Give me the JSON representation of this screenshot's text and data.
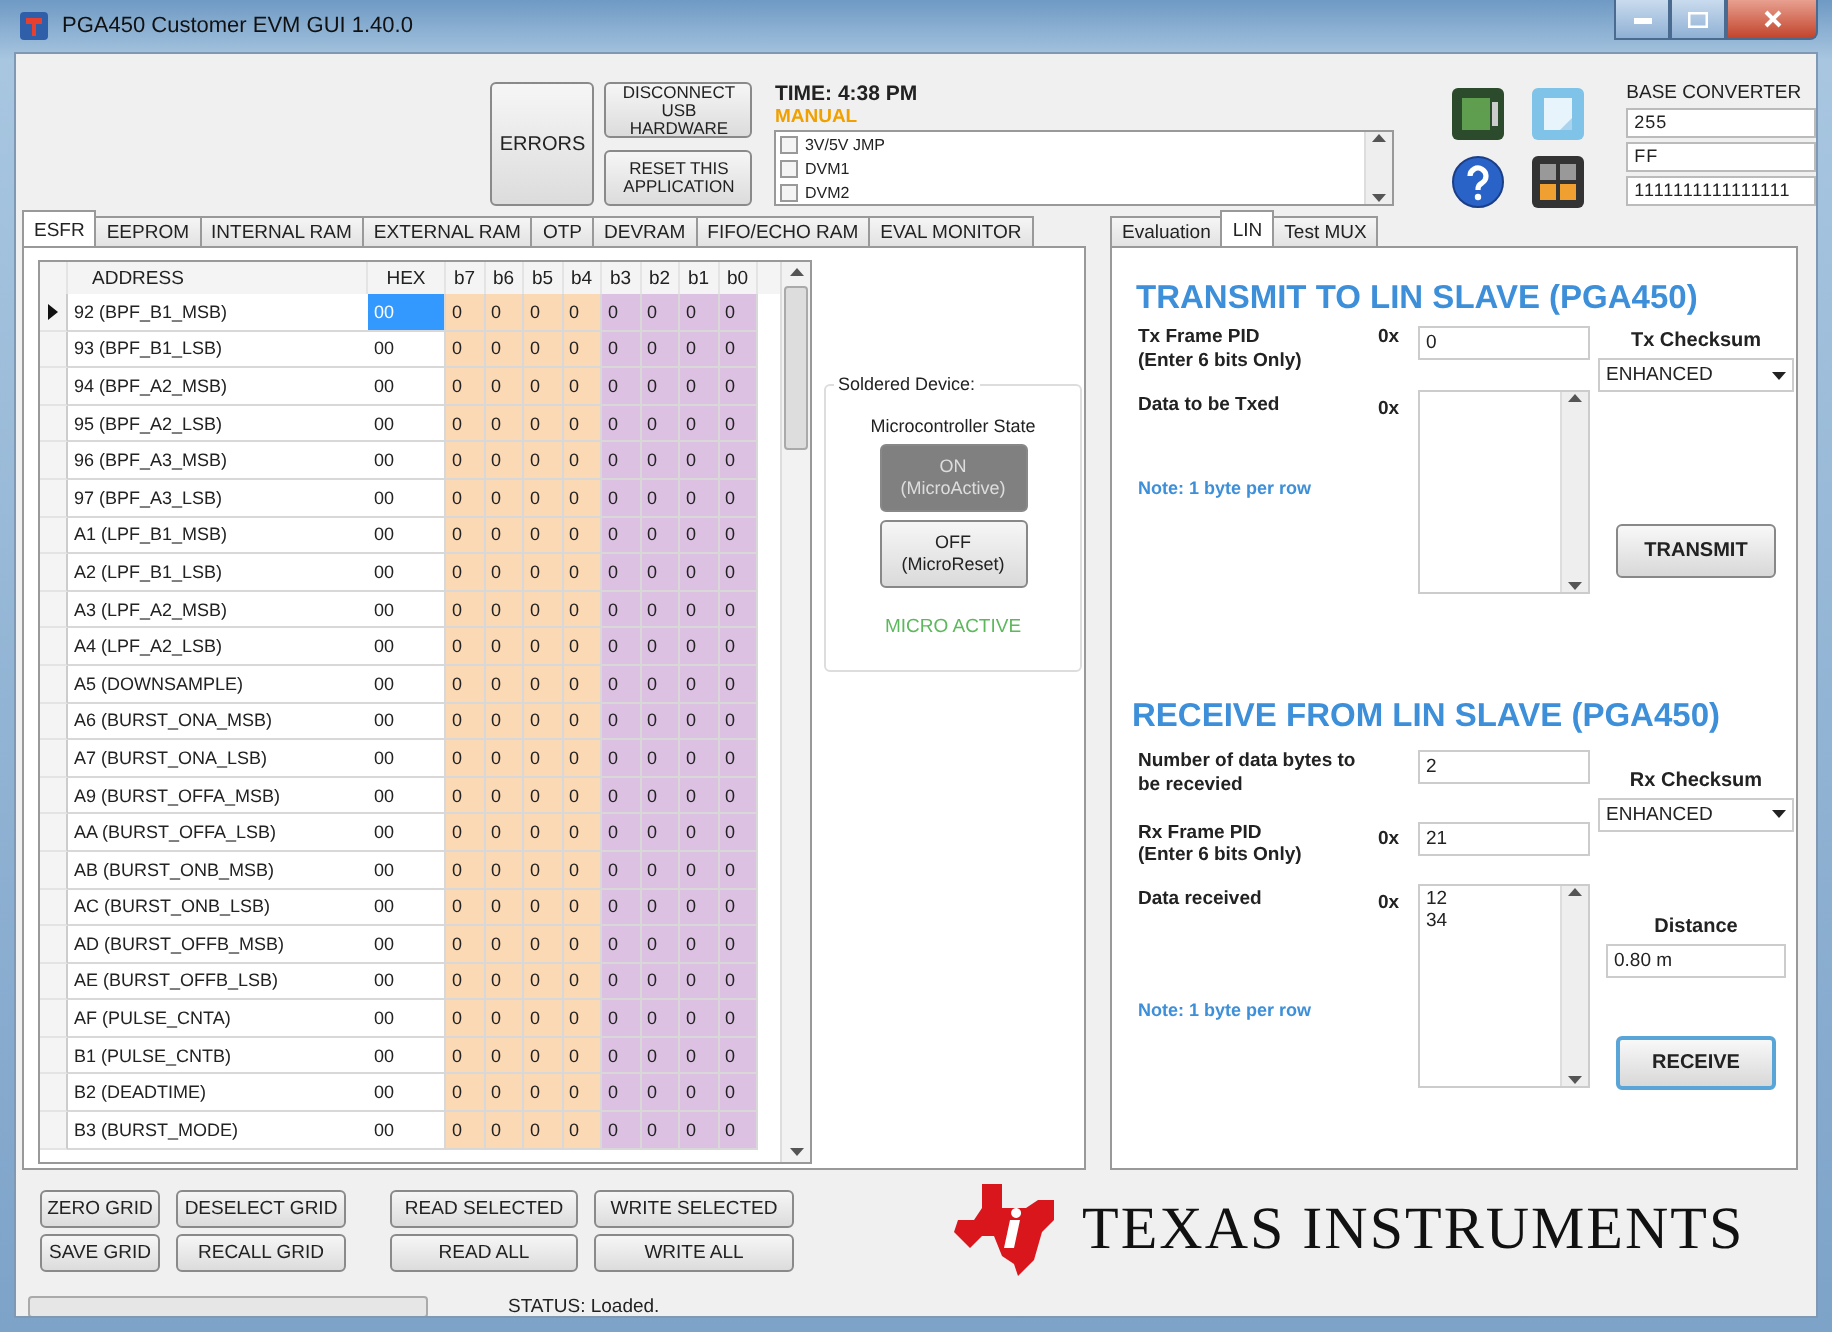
{
  "window": {
    "title": "PGA450 Customer EVM GUI  1.40.0"
  },
  "toolbar": {
    "errors_button": "ERRORS",
    "disconnect_button": "DISCONNECT USB HARDWARE",
    "reset_button": "RESET THIS APPLICATION",
    "time": "TIME:  4:38 PM",
    "mode": "MANUAL",
    "checklist": [
      {
        "label": "3V/5V JMP",
        "checked": false
      },
      {
        "label": "DVM1",
        "checked": false
      },
      {
        "label": "DVM2",
        "checked": false
      }
    ]
  },
  "base_converter": {
    "title": "BASE CONVERTER",
    "decimal": "255",
    "hex": "FF",
    "binary": "1111111111111111"
  },
  "left_tabs": [
    {
      "label": "ESFR",
      "selected": true
    },
    {
      "label": "EEPROM",
      "selected": false
    },
    {
      "label": "INTERNAL RAM",
      "selected": false
    },
    {
      "label": "EXTERNAL RAM",
      "selected": false
    },
    {
      "label": "OTP",
      "selected": false
    },
    {
      "label": "DEVRAM",
      "selected": false
    },
    {
      "label": "FIFO/ECHO RAM",
      "selected": false
    },
    {
      "label": "EVAL MONITOR",
      "selected": false
    }
  ],
  "grid": {
    "columns": [
      "ADDRESS",
      "HEX",
      "b7",
      "b6",
      "b5",
      "b4",
      "b3",
      "b2",
      "b1",
      "b0"
    ],
    "rows": [
      {
        "address": "92 (BPF_B1_MSB)",
        "hex": "00",
        "bits": [
          "0",
          "0",
          "0",
          "0",
          "0",
          "0",
          "0",
          "0"
        ],
        "selected": true
      },
      {
        "address": "93 (BPF_B1_LSB)",
        "hex": "00",
        "bits": [
          "0",
          "0",
          "0",
          "0",
          "0",
          "0",
          "0",
          "0"
        ],
        "selected": false
      },
      {
        "address": "94 (BPF_A2_MSB)",
        "hex": "00",
        "bits": [
          "0",
          "0",
          "0",
          "0",
          "0",
          "0",
          "0",
          "0"
        ],
        "selected": false
      },
      {
        "address": "95 (BPF_A2_LSB)",
        "hex": "00",
        "bits": [
          "0",
          "0",
          "0",
          "0",
          "0",
          "0",
          "0",
          "0"
        ],
        "selected": false
      },
      {
        "address": "96 (BPF_A3_MSB)",
        "hex": "00",
        "bits": [
          "0",
          "0",
          "0",
          "0",
          "0",
          "0",
          "0",
          "0"
        ],
        "selected": false
      },
      {
        "address": "97 (BPF_A3_LSB)",
        "hex": "00",
        "bits": [
          "0",
          "0",
          "0",
          "0",
          "0",
          "0",
          "0",
          "0"
        ],
        "selected": false
      },
      {
        "address": "A1 (LPF_B1_MSB)",
        "hex": "00",
        "bits": [
          "0",
          "0",
          "0",
          "0",
          "0",
          "0",
          "0",
          "0"
        ],
        "selected": false
      },
      {
        "address": "A2 (LPF_B1_LSB)",
        "hex": "00",
        "bits": [
          "0",
          "0",
          "0",
          "0",
          "0",
          "0",
          "0",
          "0"
        ],
        "selected": false
      },
      {
        "address": "A3 (LPF_A2_MSB)",
        "hex": "00",
        "bits": [
          "0",
          "0",
          "0",
          "0",
          "0",
          "0",
          "0",
          "0"
        ],
        "selected": false
      },
      {
        "address": "A4 (LPF_A2_LSB)",
        "hex": "00",
        "bits": [
          "0",
          "0",
          "0",
          "0",
          "0",
          "0",
          "0",
          "0"
        ],
        "selected": false
      },
      {
        "address": "A5 (DOWNSAMPLE)",
        "hex": "00",
        "bits": [
          "0",
          "0",
          "0",
          "0",
          "0",
          "0",
          "0",
          "0"
        ],
        "selected": false
      },
      {
        "address": "A6 (BURST_ONA_MSB)",
        "hex": "00",
        "bits": [
          "0",
          "0",
          "0",
          "0",
          "0",
          "0",
          "0",
          "0"
        ],
        "selected": false
      },
      {
        "address": "A7 (BURST_ONA_LSB)",
        "hex": "00",
        "bits": [
          "0",
          "0",
          "0",
          "0",
          "0",
          "0",
          "0",
          "0"
        ],
        "selected": false
      },
      {
        "address": "A9 (BURST_OFFA_MSB)",
        "hex": "00",
        "bits": [
          "0",
          "0",
          "0",
          "0",
          "0",
          "0",
          "0",
          "0"
        ],
        "selected": false
      },
      {
        "address": "AA (BURST_OFFA_LSB)",
        "hex": "00",
        "bits": [
          "0",
          "0",
          "0",
          "0",
          "0",
          "0",
          "0",
          "0"
        ],
        "selected": false
      },
      {
        "address": "AB (BURST_ONB_MSB)",
        "hex": "00",
        "bits": [
          "0",
          "0",
          "0",
          "0",
          "0",
          "0",
          "0",
          "0"
        ],
        "selected": false
      },
      {
        "address": "AC (BURST_ONB_LSB)",
        "hex": "00",
        "bits": [
          "0",
          "0",
          "0",
          "0",
          "0",
          "0",
          "0",
          "0"
        ],
        "selected": false
      },
      {
        "address": "AD (BURST_OFFB_MSB)",
        "hex": "00",
        "bits": [
          "0",
          "0",
          "0",
          "0",
          "0",
          "0",
          "0",
          "0"
        ],
        "selected": false
      },
      {
        "address": "AE (BURST_OFFB_LSB)",
        "hex": "00",
        "bits": [
          "0",
          "0",
          "0",
          "0",
          "0",
          "0",
          "0",
          "0"
        ],
        "selected": false
      },
      {
        "address": "AF (PULSE_CNTA)",
        "hex": "00",
        "bits": [
          "0",
          "0",
          "0",
          "0",
          "0",
          "0",
          "0",
          "0"
        ],
        "selected": false
      },
      {
        "address": "B1 (PULSE_CNTB)",
        "hex": "00",
        "bits": [
          "0",
          "0",
          "0",
          "0",
          "0",
          "0",
          "0",
          "0"
        ],
        "selected": false
      },
      {
        "address": "B2 (DEADTIME)",
        "hex": "00",
        "bits": [
          "0",
          "0",
          "0",
          "0",
          "0",
          "0",
          "0",
          "0"
        ],
        "selected": false
      },
      {
        "address": "B3 (BURST_MODE)",
        "hex": "00",
        "bits": [
          "0",
          "0",
          "0",
          "0",
          "0",
          "0",
          "0",
          "0"
        ],
        "selected": false
      }
    ]
  },
  "microcontroller": {
    "group_title": "Soldered Device:",
    "subtitle": "Microcontroller State",
    "buttons": [
      {
        "label": "ON",
        "sublabel": "(MicroActive)",
        "selected": true
      },
      {
        "label": "OFF",
        "sublabel": "(MicroReset)",
        "selected": false
      }
    ],
    "status": "MICRO ACTIVE"
  },
  "right_tabs": [
    {
      "label": "Evaluation",
      "selected": false
    },
    {
      "label": "LIN",
      "selected": true
    },
    {
      "label": "Test MUX",
      "selected": false
    }
  ],
  "transmit": {
    "heading": "TRANSMIT TO LIN SLAVE (PGA450)",
    "pid_label": "Tx Frame PID",
    "pid_hint": "(Enter 6 bits Only)",
    "pid_prefix": "0x",
    "pid_value": "0",
    "data_label": "Data to be Txed",
    "data_prefix": "0x",
    "note": "Note: 1 byte per row",
    "checksum_label": "Tx Checksum",
    "checksum": "ENHANCED",
    "button": "TRANSMIT"
  },
  "receive": {
    "heading": "RECEIVE FROM LIN SLAVE (PGA450)",
    "count_label": "Number of data bytes to be recevied",
    "count_value": "2",
    "pid_label": "Rx Frame PID",
    "pid_hint": "(Enter 6 bits Only)",
    "pid_prefix": "0x",
    "pid_value": "21",
    "data_label": "Data received",
    "data_prefix": "0x",
    "data_lines": [
      "12",
      "34"
    ],
    "note": "Note: 1 byte per row",
    "checksum_label": "Rx Checksum",
    "checksum": "ENHANCED",
    "distance_label": "Distance",
    "distance": "0.80 m",
    "button": "RECEIVE"
  },
  "grid_buttons": [
    [
      "ZERO GRID",
      "DESELECT GRID",
      "READ SELECTED",
      "WRITE SELECTED"
    ],
    [
      "SAVE GRID",
      "RECALL GRID",
      "READ ALL",
      "WRITE ALL"
    ]
  ],
  "progress": {
    "level": 0
  },
  "status": "STATUS: Loaded.",
  "logo": {
    "text": "TEXAS INSTRUMENTS"
  }
}
